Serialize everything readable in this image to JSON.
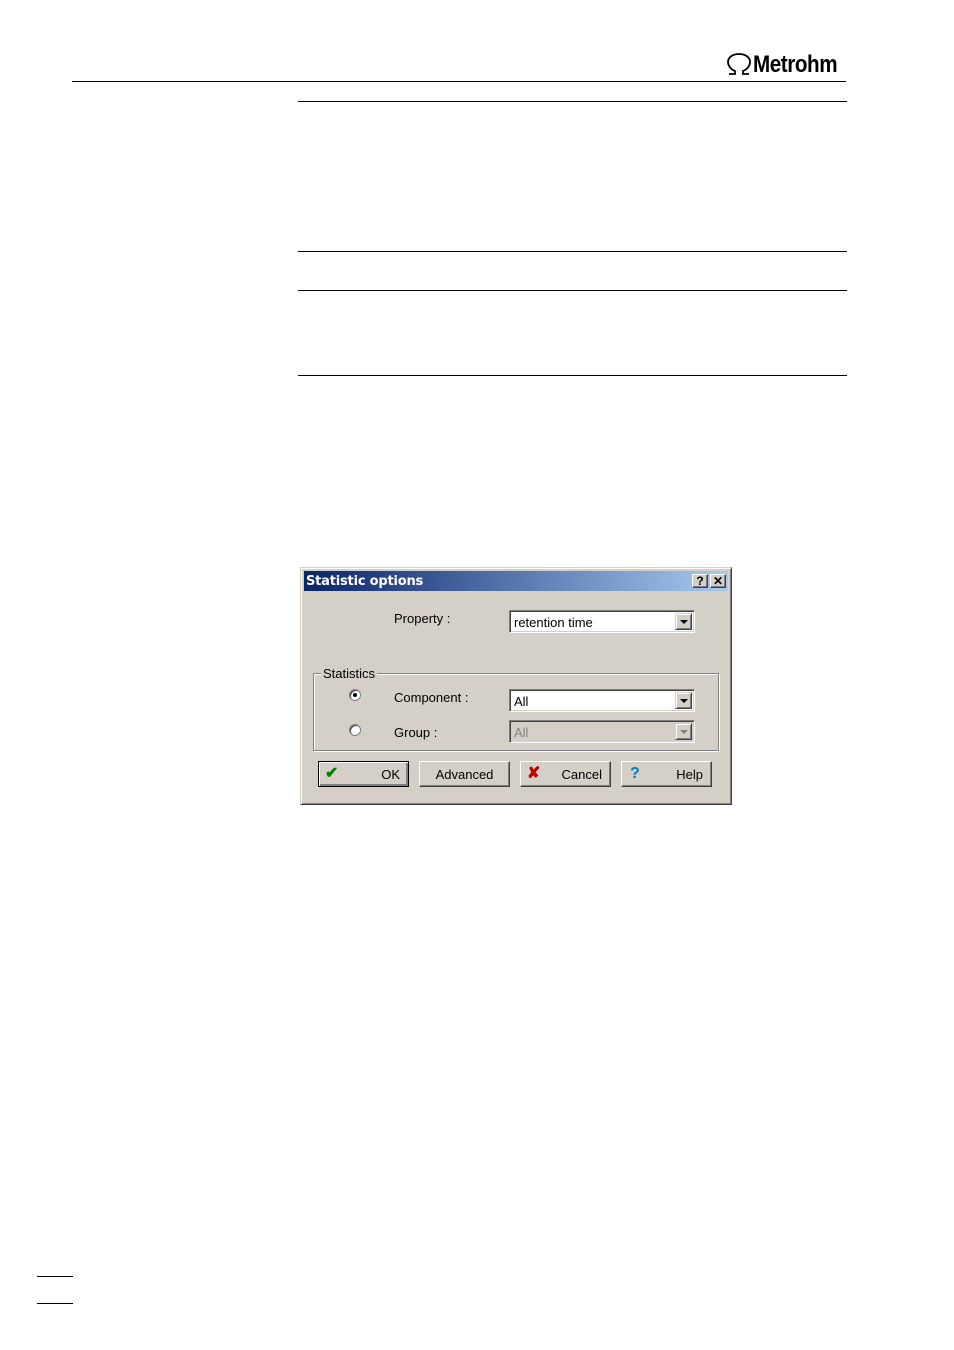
{
  "header": {
    "brand": "Metrohm"
  },
  "dialog": {
    "title": "Statistic options",
    "title_buttons": {
      "help": "?",
      "close": "✕"
    },
    "property_label": "Property :",
    "property_value": "retention time",
    "statistics_legend": "Statistics",
    "component_label": "Component :",
    "component_value": "All",
    "component_selected": true,
    "group_label": "Group :",
    "group_value": "All",
    "group_selected": false,
    "buttons": {
      "ok": "OK",
      "advanced": "Advanced",
      "cancel": "Cancel",
      "help": "Help"
    },
    "colors": {
      "ok_icon": "#008000",
      "cancel_icon": "#c00000",
      "help_icon": "#0080c0"
    }
  }
}
